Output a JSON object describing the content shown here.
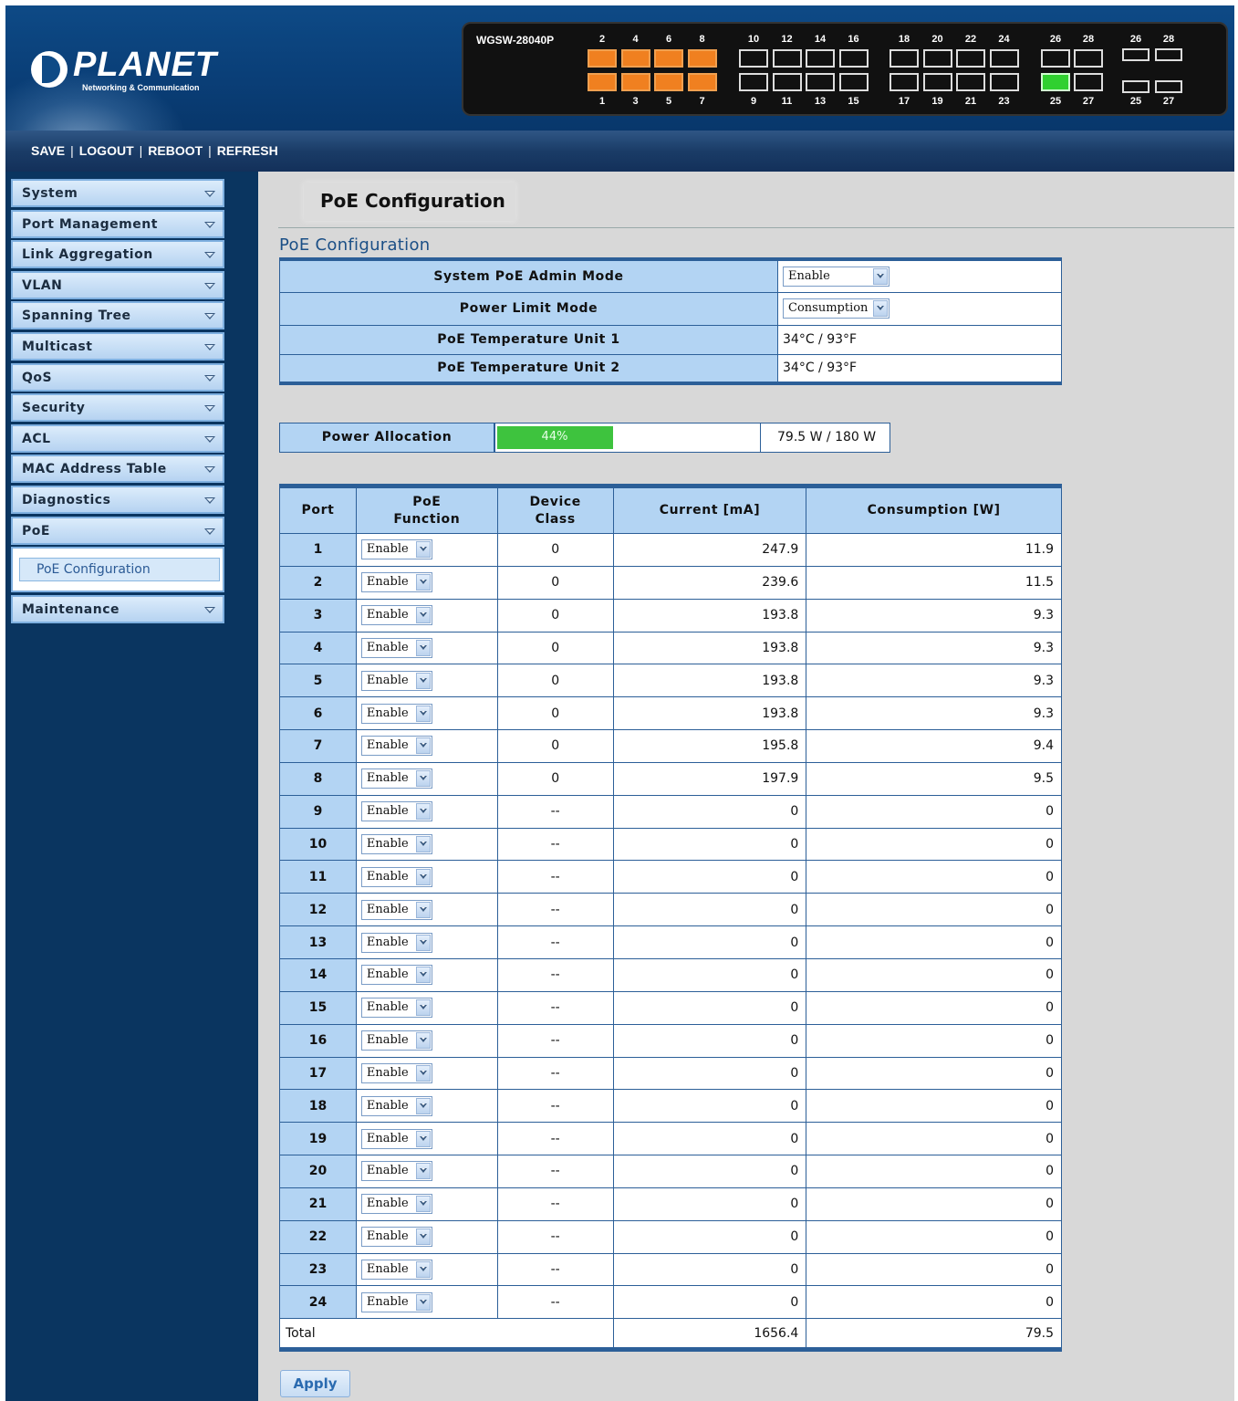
{
  "header": {
    "brand": "PLANET",
    "tagline": "Networking & Communication",
    "device_model": "WGSW-28040P",
    "top_port_numbers": [
      "2",
      "4",
      "6",
      "8",
      "10",
      "12",
      "14",
      "16",
      "18",
      "20",
      "22",
      "24",
      "26",
      "28"
    ],
    "bottom_port_numbers": [
      "1",
      "3",
      "5",
      "7",
      "9",
      "11",
      "13",
      "15",
      "17",
      "19",
      "21",
      "23",
      "25",
      "27"
    ],
    "sfp_top_numbers": [
      "26",
      "28"
    ],
    "sfp_bottom_numbers": [
      "25",
      "27"
    ],
    "colors": {
      "port_active_poe": "#f08020",
      "port_link_up": "#30d030",
      "port_idle": "#111111"
    }
  },
  "navbar": {
    "save": "SAVE",
    "logout": "LOGOUT",
    "reboot": "REBOOT",
    "refresh": "REFRESH",
    "separator": "|"
  },
  "sidebar": {
    "items": [
      {
        "label": "System"
      },
      {
        "label": "Port Management"
      },
      {
        "label": "Link Aggregation"
      },
      {
        "label": "VLAN"
      },
      {
        "label": "Spanning Tree"
      },
      {
        "label": "Multicast"
      },
      {
        "label": "QoS"
      },
      {
        "label": "Security"
      },
      {
        "label": "ACL"
      },
      {
        "label": "MAC Address Table"
      },
      {
        "label": "Diagnostics"
      },
      {
        "label": "PoE"
      }
    ],
    "submenu_active": "PoE Configuration",
    "last_item": "Maintenance"
  },
  "main": {
    "page_title": "PoE Configuration",
    "section_title": "PoE Configuration",
    "config": {
      "admin_mode_label": "System PoE Admin Mode",
      "admin_mode_value": "Enable",
      "power_limit_label": "Power Limit Mode",
      "power_limit_value": "Consumption",
      "temp1_label": "PoE Temperature Unit 1",
      "temp1_value": "34°C / 93°F",
      "temp2_label": "PoE Temperature Unit 2",
      "temp2_value": "34°C / 93°F"
    },
    "power_allocation": {
      "label": "Power Allocation",
      "percent_text": "44%",
      "percent_value": 44,
      "value_text": "79.5 W / 180 W",
      "bar_color": "#3ec33e"
    },
    "table": {
      "headers": {
        "port": "Port",
        "function_line1": "PoE",
        "function_line2": "Function",
        "class_line1": "Device",
        "class_line2": "Class",
        "current": "Current [mA]",
        "consumption": "Consumption [W]"
      },
      "rows": [
        {
          "port": "1",
          "function": "Enable",
          "class": "0",
          "current": "247.9",
          "consumption": "11.9"
        },
        {
          "port": "2",
          "function": "Enable",
          "class": "0",
          "current": "239.6",
          "consumption": "11.5"
        },
        {
          "port": "3",
          "function": "Enable",
          "class": "0",
          "current": "193.8",
          "consumption": "9.3"
        },
        {
          "port": "4",
          "function": "Enable",
          "class": "0",
          "current": "193.8",
          "consumption": "9.3"
        },
        {
          "port": "5",
          "function": "Enable",
          "class": "0",
          "current": "193.8",
          "consumption": "9.3"
        },
        {
          "port": "6",
          "function": "Enable",
          "class": "0",
          "current": "193.8",
          "consumption": "9.3"
        },
        {
          "port": "7",
          "function": "Enable",
          "class": "0",
          "current": "195.8",
          "consumption": "9.4"
        },
        {
          "port": "8",
          "function": "Enable",
          "class": "0",
          "current": "197.9",
          "consumption": "9.5"
        },
        {
          "port": "9",
          "function": "Enable",
          "class": "--",
          "current": "0",
          "consumption": "0"
        },
        {
          "port": "10",
          "function": "Enable",
          "class": "--",
          "current": "0",
          "consumption": "0"
        },
        {
          "port": "11",
          "function": "Enable",
          "class": "--",
          "current": "0",
          "consumption": "0"
        },
        {
          "port": "12",
          "function": "Enable",
          "class": "--",
          "current": "0",
          "consumption": "0"
        },
        {
          "port": "13",
          "function": "Enable",
          "class": "--",
          "current": "0",
          "consumption": "0"
        },
        {
          "port": "14",
          "function": "Enable",
          "class": "--",
          "current": "0",
          "consumption": "0"
        },
        {
          "port": "15",
          "function": "Enable",
          "class": "--",
          "current": "0",
          "consumption": "0"
        },
        {
          "port": "16",
          "function": "Enable",
          "class": "--",
          "current": "0",
          "consumption": "0"
        },
        {
          "port": "17",
          "function": "Enable",
          "class": "--",
          "current": "0",
          "consumption": "0"
        },
        {
          "port": "18",
          "function": "Enable",
          "class": "--",
          "current": "0",
          "consumption": "0"
        },
        {
          "port": "19",
          "function": "Enable",
          "class": "--",
          "current": "0",
          "consumption": "0"
        },
        {
          "port": "20",
          "function": "Enable",
          "class": "--",
          "current": "0",
          "consumption": "0"
        },
        {
          "port": "21",
          "function": "Enable",
          "class": "--",
          "current": "0",
          "consumption": "0"
        },
        {
          "port": "22",
          "function": "Enable",
          "class": "--",
          "current": "0",
          "consumption": "0"
        },
        {
          "port": "23",
          "function": "Enable",
          "class": "--",
          "current": "0",
          "consumption": "0"
        },
        {
          "port": "24",
          "function": "Enable",
          "class": "--",
          "current": "0",
          "consumption": "0"
        }
      ],
      "total_label": "Total",
      "total_current": "1656.4",
      "total_consumption": "79.5"
    },
    "apply_label": "Apply"
  }
}
